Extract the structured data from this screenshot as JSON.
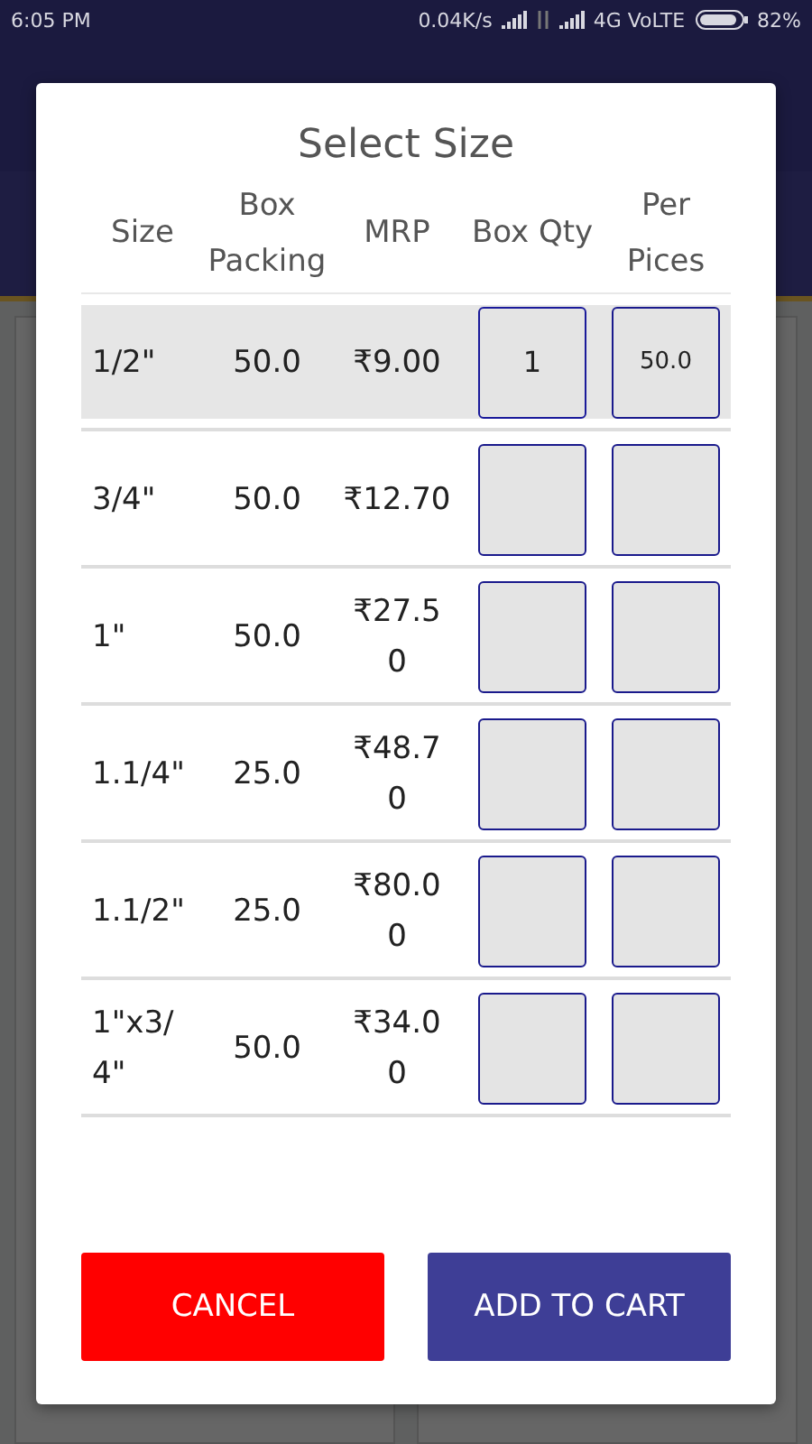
{
  "status_bar": {
    "time": "6:05 PM",
    "speed": "0.04K/s",
    "network": "4G VoLTE",
    "battery": "82%"
  },
  "dialog": {
    "title": "Select Size",
    "columns": [
      "Size",
      "Box Packing",
      "MRP",
      "Box Qty",
      "Per Pices"
    ],
    "rows": [
      {
        "size": "1/2\"",
        "box_packing": "50.0",
        "mrp": "₹9.00",
        "box_qty": "1",
        "per_pieces": "50.0",
        "selected": true
      },
      {
        "size": "3/4\"",
        "box_packing": "50.0",
        "mrp": "₹12.70",
        "box_qty": "",
        "per_pieces": "",
        "selected": false
      },
      {
        "size": "1\"",
        "box_packing": "50.0",
        "mrp": "₹27.50",
        "box_qty": "",
        "per_pieces": "",
        "selected": false
      },
      {
        "size": "1.1/4\"",
        "box_packing": "25.0",
        "mrp": "₹48.70",
        "box_qty": "",
        "per_pieces": "",
        "selected": false
      },
      {
        "size": "1.1/2\"",
        "box_packing": "25.0",
        "mrp": "₹80.00",
        "box_qty": "",
        "per_pieces": "",
        "selected": false
      },
      {
        "size": "1\"x3/4\"",
        "box_packing": "50.0",
        "mrp": "₹34.00",
        "box_qty": "",
        "per_pieces": "",
        "selected": false
      }
    ],
    "buttons": [
      {
        "label": "CANCEL",
        "kind": "cancel"
      },
      {
        "label": "ADD TO CART",
        "kind": "confirm"
      }
    ]
  }
}
